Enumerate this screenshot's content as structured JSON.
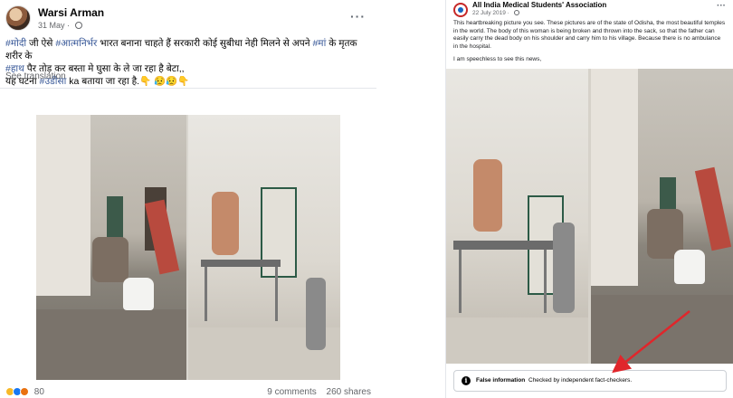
{
  "left_post": {
    "author": "Warsi Arman",
    "date": "31 May",
    "more": "···",
    "text_line1_tag1": "#मोदी",
    "text_line1_a": " जी ऐसे ",
    "text_line1_tag2": "#आत्मनिर्भर",
    "text_line1_b": " भारत बनाना चाहते हैं सरकारी कोई सुबीधा नेही मिलने से अपने ",
    "text_line1_tag3": "#मां",
    "text_line1_c": " के मृतक शरीर के",
    "text_line2_tag": "#हाथ",
    "text_line2": " पैर तोड़ कर बस्ता मे घुसा के ले जा रहा है बेटा,,",
    "text_line3_a": "यह घटना ",
    "text_line3_tag": "#उडीसा",
    "text_line3_b": " ka बताया जा रहा है.👇 😥😥👇",
    "see_translation": "See translation",
    "reaction_count": "80",
    "comments": "9 comments",
    "shares": "260 shares"
  },
  "right_post": {
    "author": "All India Medical Students' Association",
    "date": "22 July 2019 · ",
    "more": "···",
    "text": "This heartbreaking picture you see. These pictures are of the state of Odisha, the most beautiful temples in the world. The body of this woman is being broken and thrown into the sack, so that the father can easily carry the dead body on his shoulder and carry him to his village. Because there is no ambulance in the hospital.",
    "text2": "I am speechless to see this news,",
    "fact_check_title": "False information",
    "fact_check_sub": "Checked by independent fact-checkers."
  },
  "colors": {
    "hashtag": "#385898",
    "arrow": "#e0262b",
    "like": "#1877f2",
    "love": "#f33e58",
    "haha": "#f7b928"
  }
}
